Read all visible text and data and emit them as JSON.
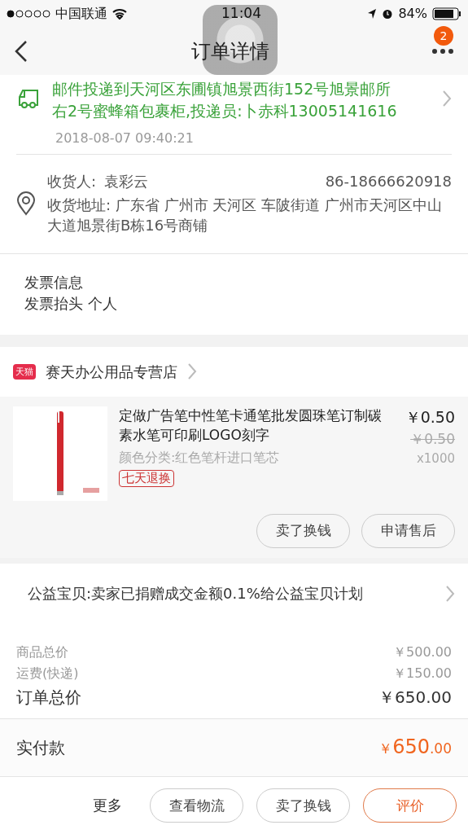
{
  "status_bar": {
    "carrier": "中国联通",
    "time": "11:04",
    "battery": "84%"
  },
  "nav": {
    "title": "订单详情",
    "badge": "2"
  },
  "logistics": {
    "text": "邮件投递到天河区东圃镇旭景西街152号旭景邮所右2号蜜蜂箱包裹柜,投递员:卜赤科13005141616",
    "time": "2018-08-07 09:40:21"
  },
  "address": {
    "receiver_label": "收货人:",
    "receiver": "袁彩云",
    "phone": "86-18666620918",
    "address": "收货地址: 广东省 广州市 天河区 车陂街道 广州市天河区中山大道旭景街B栋16号商铺"
  },
  "invoice": {
    "title": "发票信息",
    "detail": "发票抬头 个人"
  },
  "shop": {
    "badge": "天猫",
    "name": "赛天办公用品专营店"
  },
  "product": {
    "title": "定做广告笔中性笔卡通笔批发圆珠笔订制碳素水笔可印刷LOGO刻字",
    "sku": "颜色分类:红色笔杆进口笔芯",
    "tag": "七天退换",
    "price": "￥0.50",
    "original_price": "￥0.50",
    "quantity": "x1000",
    "buttons": [
      "卖了换钱",
      "申请售后"
    ]
  },
  "charity": "公益宝贝:卖家已捐赠成交金额0.1%给公益宝贝计划",
  "summary": [
    {
      "label": "商品总价",
      "value": "￥500.00",
      "kind": "minor"
    },
    {
      "label": "运费(快递)",
      "value": "￥150.00",
      "kind": "minor"
    },
    {
      "label": "订单总价",
      "value": "￥650.00",
      "kind": "total"
    }
  ],
  "paid": {
    "label": "实付款",
    "currency": "￥",
    "integer": "650",
    "decimal": ".00"
  },
  "bottom_bar": {
    "more": "更多",
    "buttons": [
      {
        "label": "查看物流",
        "highlighted": false
      },
      {
        "label": "卖了换钱",
        "highlighted": false
      },
      {
        "label": "评价",
        "highlighted": true
      }
    ]
  }
}
